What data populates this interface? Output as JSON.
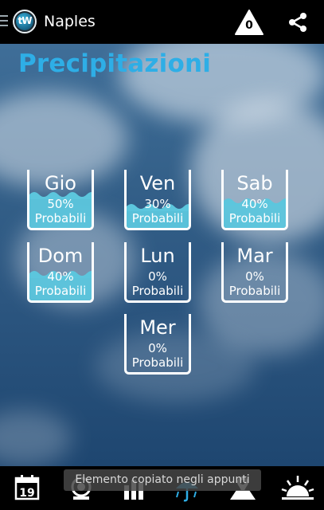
{
  "header": {
    "logo_text": "tW",
    "city": "Naples",
    "alert_count": "0"
  },
  "main": {
    "title": "Precipitazioni",
    "days": [
      {
        "day": "Gio",
        "pct": "50%",
        "label": "Probabili",
        "level": 0.5
      },
      {
        "day": "Ven",
        "pct": "30%",
        "label": "Probabili",
        "level": 0.3
      },
      {
        "day": "Sab",
        "pct": "40%",
        "label": "Probabili",
        "level": 0.4
      },
      {
        "day": "Dom",
        "pct": "40%",
        "label": "Probabili",
        "level": 0.4
      },
      {
        "day": "Lun",
        "pct": "0%",
        "label": "Probabili",
        "level": 0
      },
      {
        "day": "Mar",
        "pct": "0%",
        "label": "Probabili",
        "level": 0
      },
      {
        "day": "Mer",
        "pct": "0%",
        "label": "Probabili",
        "level": 0
      }
    ]
  },
  "bottom_nav": {
    "calendar_day": "19",
    "icons": [
      "calendar-icon",
      "radar-icon",
      "charts-icon",
      "umbrella-icon",
      "map-icon",
      "sunrise-icon"
    ]
  },
  "toast": {
    "text": "Elemento copiato negli appunti"
  },
  "colors": {
    "accent": "#2eaee6",
    "water": "#5cc6dd",
    "bar": "#000000"
  }
}
